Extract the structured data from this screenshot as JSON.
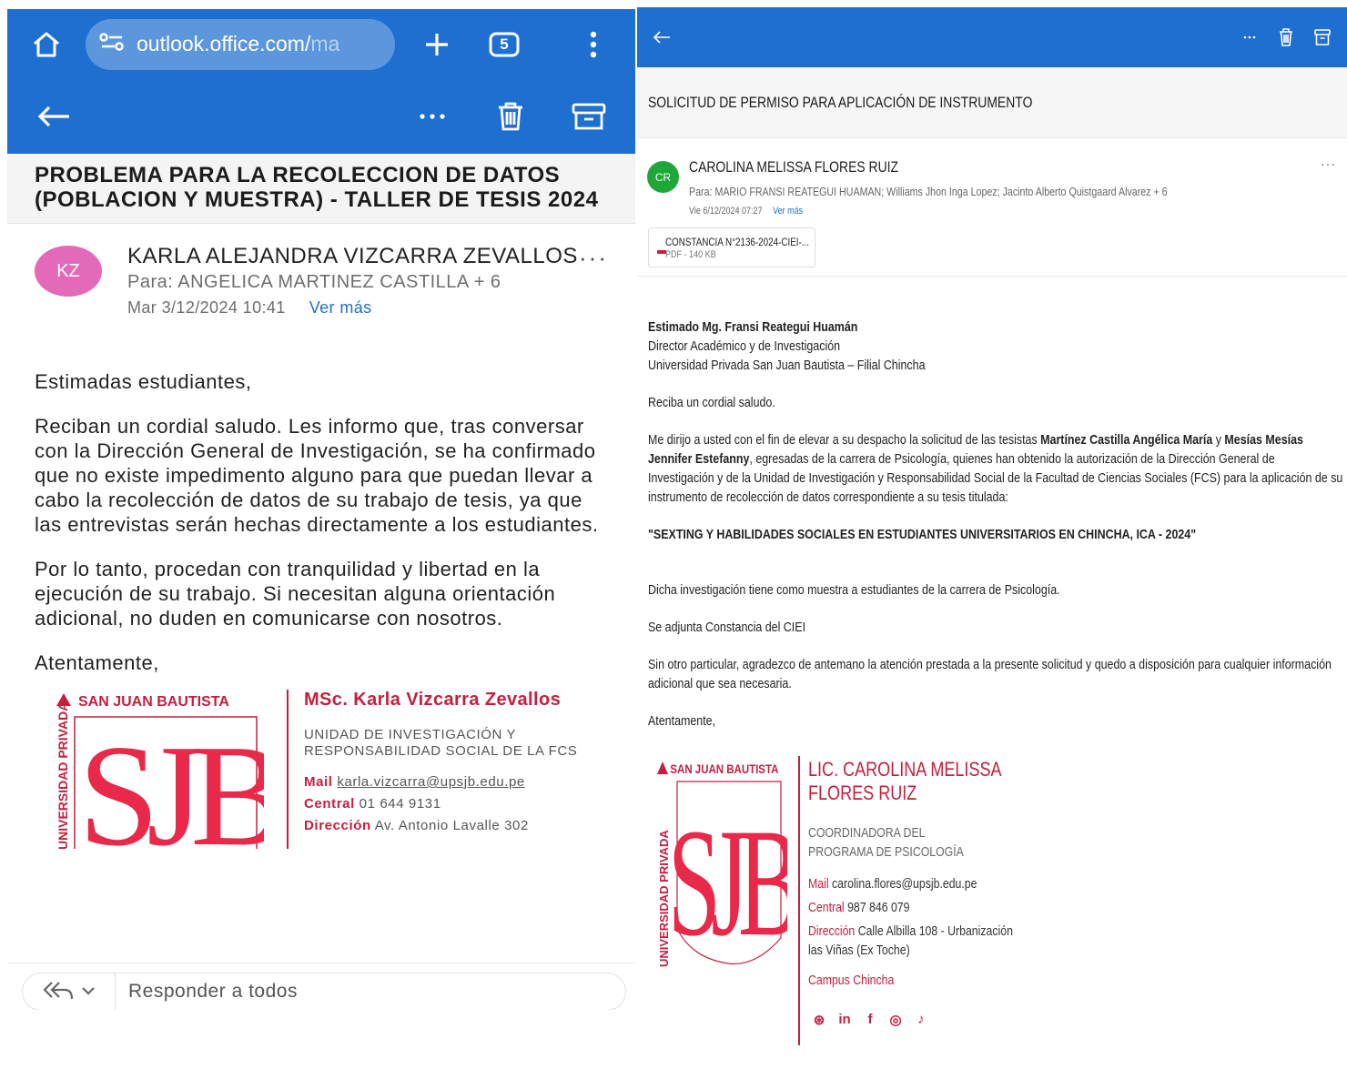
{
  "left": {
    "browser": {
      "url_visible": "outlook.office.com/",
      "url_fade": "ma",
      "tab_count": "5"
    },
    "subject": "PROBLEMA PARA LA RECOLECCION DE DATOS (POBLACION Y MUESTRA) - TALLER DE TESIS 2024",
    "sender": {
      "initials": "KZ",
      "name": "KARLA ALEJANDRA VIZCARRA ZEVALLOS",
      "to": "Para: ANGELICA MARTINEZ CASTILLA  + 6",
      "date": "Mar 3/12/2024 10:41",
      "ver_mas": "Ver más",
      "more": "···"
    },
    "body": [
      "Estimadas estudiantes,",
      "Reciban un cordial saludo. Les informo que, tras conversar con la Dirección General de Investigación, se ha confirmado que no existe impedimento alguno para que puedan llevar a cabo la recolección de datos de su trabajo de tesis, ya que las entrevistas serán hechas directamente a los estudiantes.",
      "Por lo tanto, procedan con tranquilidad y libertad en la ejecución de su trabajo. Si necesitan alguna orientación adicional, no duden en comunicarse con nosotros.",
      "Atentamente,"
    ],
    "signature": {
      "logo_top": "SAN JUAN BAUTISTA",
      "logo_side": "UNIVERSIDAD PRIVADA",
      "logo_letters": "SJB",
      "name": "MSc. Karla Vizcarra Zevallos",
      "role": "UNIDAD DE INVESTIGACIÓN Y RESPONSABILIDAD SOCIAL DE LA FCS",
      "mail_label": "Mail",
      "mail": "karla.vizcarra@upsjb.edu.pe",
      "central_label": "Central",
      "central": "01 644 9131",
      "dir_label": "Dirección",
      "dir": "Av. Antonio Lavalle 302"
    },
    "reply_label": "Responder a todos"
  },
  "right": {
    "subject": "SOLICITUD DE PERMISO PARA APLICACIÓN DE INSTRUMENTO",
    "sender": {
      "initials": "CR",
      "name": "CAROLINA MELISSA FLORES RUIZ",
      "to": "Para: MARIO FRANSI REATEGUI HUAMAN;  Williams Jhon Inga Lopez;  Jacinto Alberto Quistgaard Alvarez  + 6",
      "date": "Vie 6/12/2024 07:27",
      "ver_mas": "Ver más",
      "more": "···"
    },
    "attachment": {
      "name": "CONSTANCIA N°2136-2024-CIEI-...",
      "meta": "PDF - 140 KB"
    },
    "body": {
      "greeting_name": "Estimado Mg. Fransi Reategui Huamán",
      "greeting_role": "Director Académico y de Investigación",
      "greeting_org": "Universidad Privada San Juan Bautista – Filial Chincha",
      "salute": "Reciba un cordial saludo.",
      "p1_a": "Me dirijo a usted con el fin de elevar a su despacho la solicitud de las tesistas ",
      "p1_b": "Martínez Castilla Angélica María",
      "p1_c": " y ",
      "p1_d": "Mesías Mesías Jennifer Estefanny",
      "p1_e": ", egresadas de la carrera de Psicología, quienes han obtenido la autorización de la Dirección General de Investigación y de la Unidad de Investigación y Responsabilidad Social de la Facultad de Ciencias Sociales (FCS) para la aplicación de su instrumento de recolección de datos correspondiente a su tesis titulada:",
      "title": "\"SEXTING Y HABILIDADES SOCIALES EN ESTUDIANTES UNIVERSITARIOS EN CHINCHA, ICA - 2024\"",
      "p2": "Dicha investigación tiene como muestra a estudiantes de la carrera de Psicología.",
      "p3": "Se adjunta Constancia del CIEI",
      "p4": "Sin otro particular, agradezco de antemano la atención prestada a la presente solicitud y quedo a disposición para cualquier información adicional que sea necesaria.",
      "closing": "Atentamente,"
    },
    "signature": {
      "logo_top": "SAN JUAN BAUTISTA",
      "logo_side": "UNIVERSIDAD PRIVADA",
      "logo_letters": "SJB",
      "name": "LIC. CAROLINA MELISSA FLORES RUIZ",
      "role": "COORDINADORA DEL PROGRAMA DE PSICOLOGÍA",
      "mail_label": "Mail",
      "mail": "carolina.flores@upsjb.edu.pe",
      "central_label": "Central",
      "central": "987 846 079",
      "dir_label": "Dirección",
      "dir": "Calle Albilla 108 - Urbanización las Viñas (Ex Toche)",
      "campus": "Campus Chincha",
      "social": [
        "⊛",
        "in",
        "f",
        "◎",
        "♪"
      ]
    }
  },
  "colors": {
    "outlook_blue": "#1e6fcf",
    "brand_red": "#c41f3e",
    "avatar_kz": "#e36ab8",
    "avatar_cr": "#1ea83a"
  }
}
